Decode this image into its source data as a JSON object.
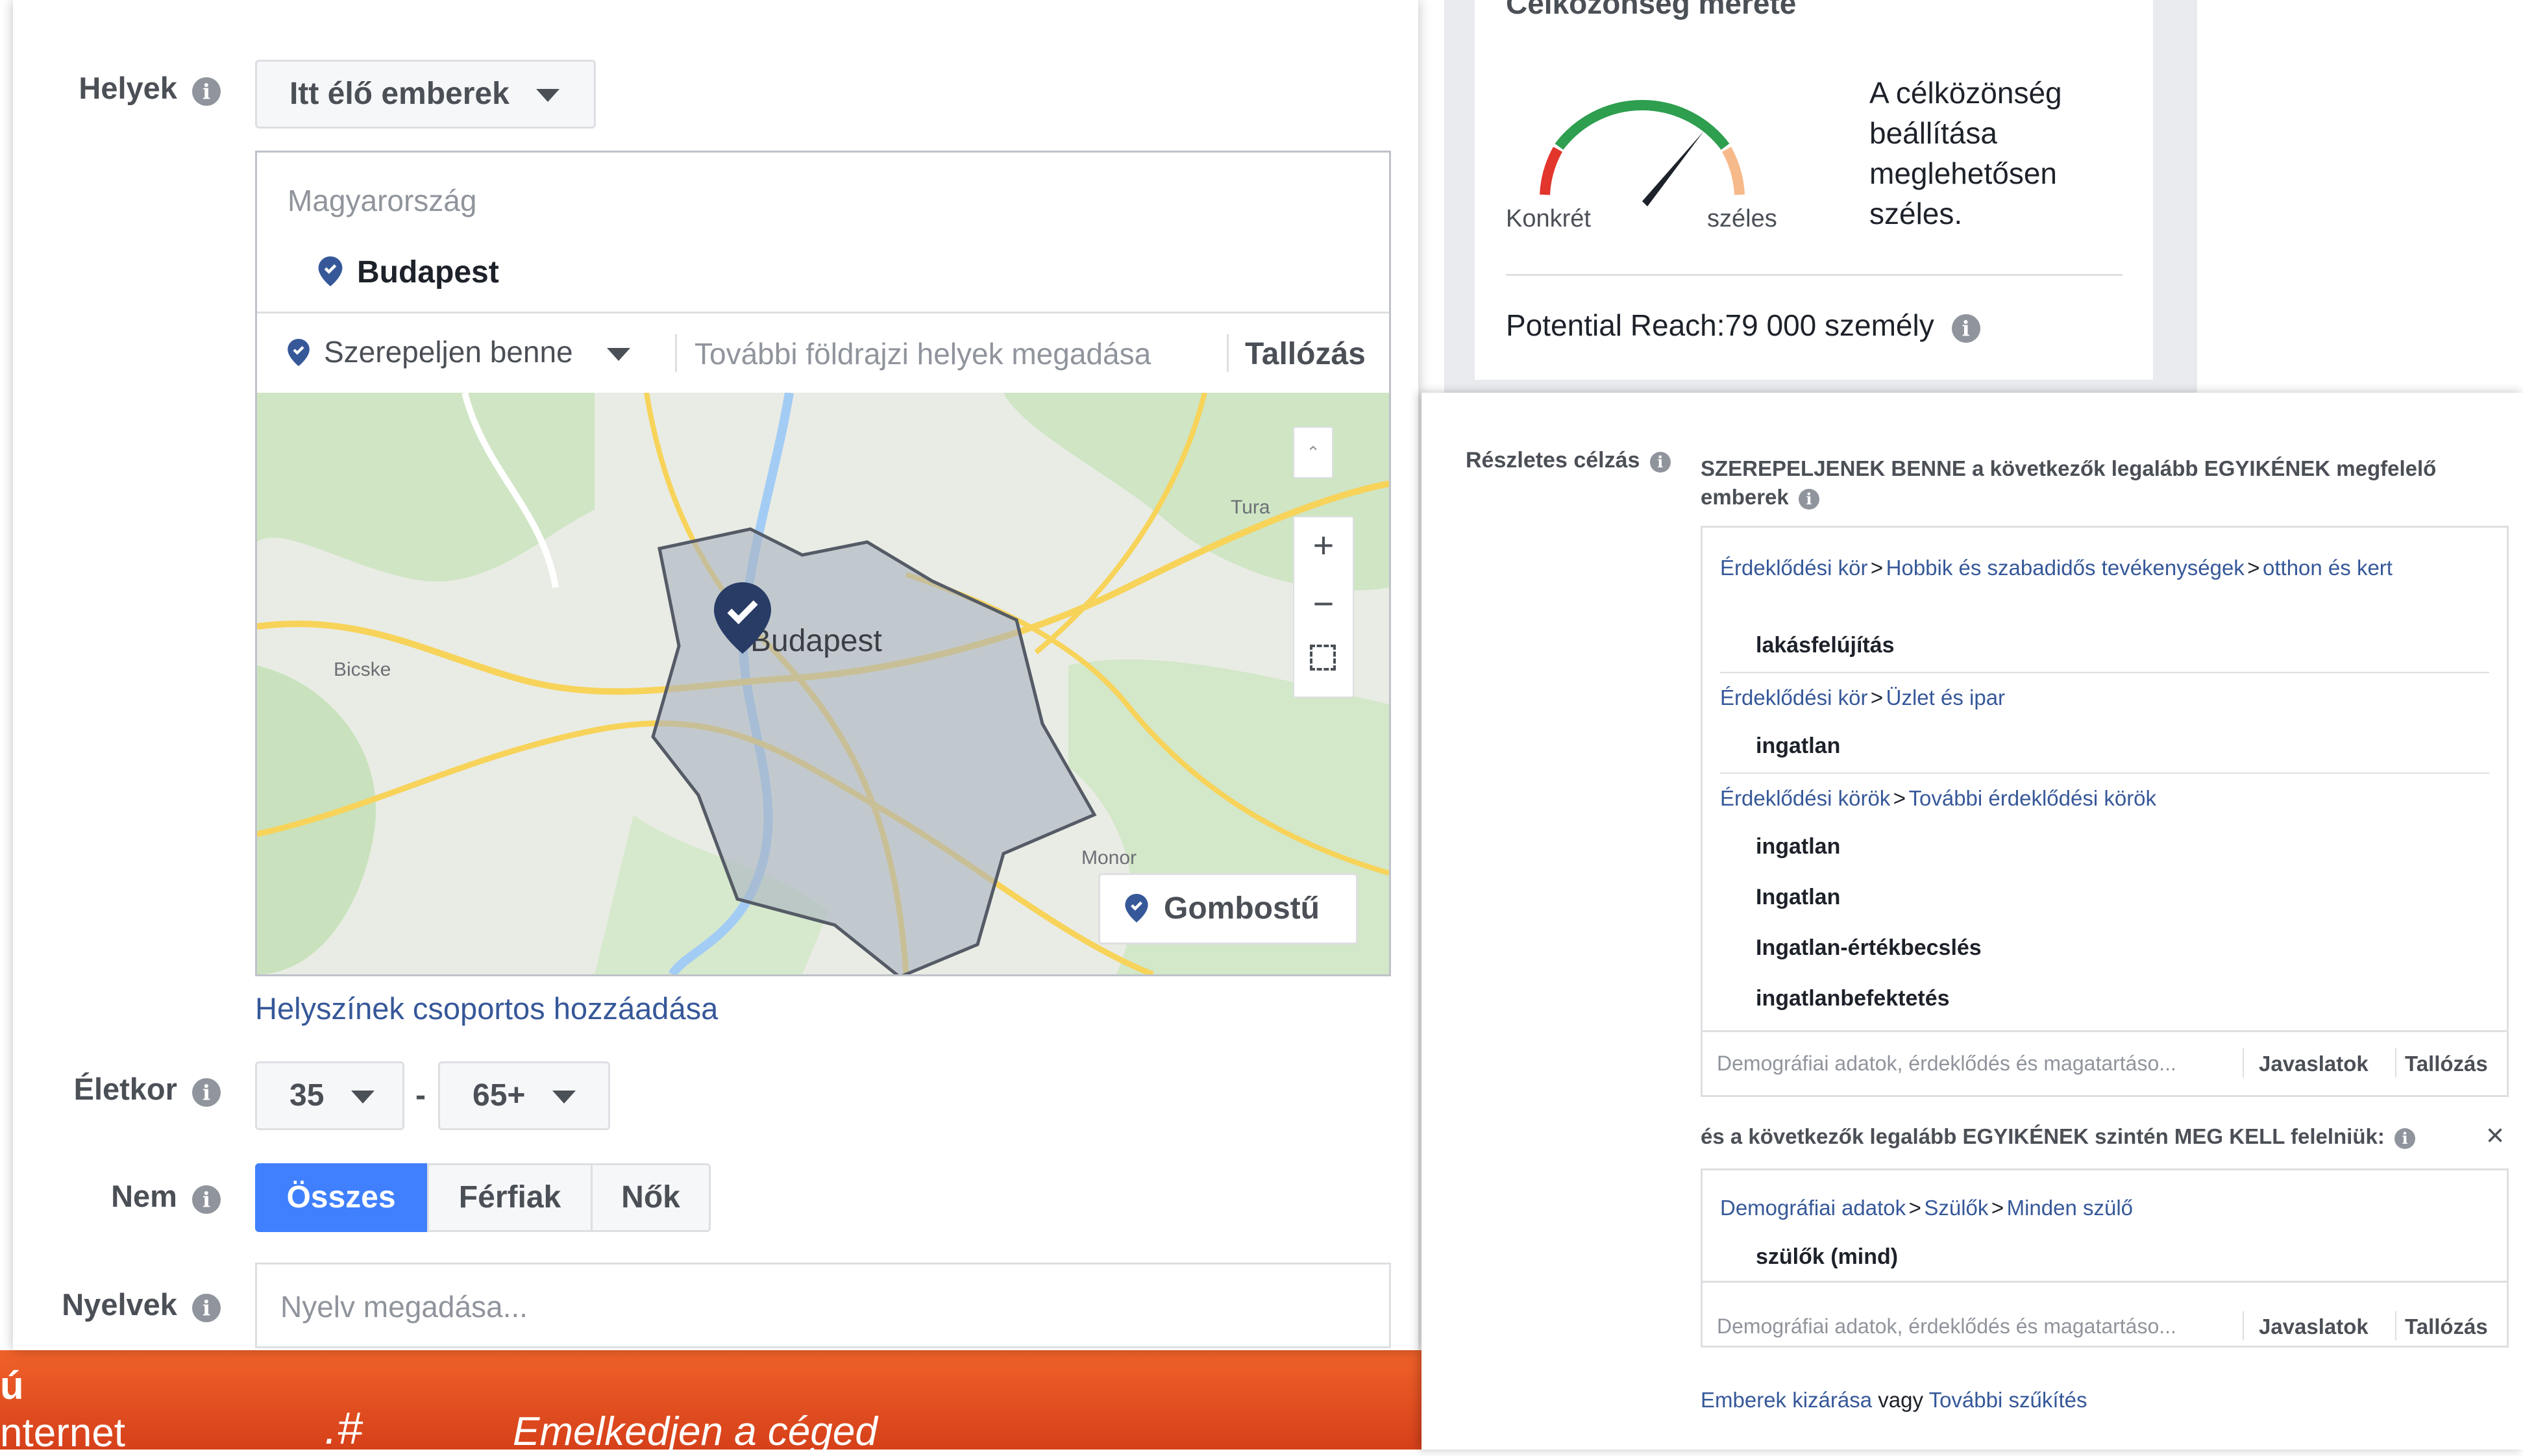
{
  "locations": {
    "label": "Helyek",
    "type_button": "Itt élő emberek",
    "country": "Magyarország",
    "city": "Budapest",
    "include_select": "Szerepeljen benne",
    "search_placeholder": "További földrajzi helyek megadása",
    "browse": "Tallózás",
    "bulk_add": "Helyszínek csoportos hozzáadása"
  },
  "map": {
    "city_label": "Budapest",
    "labels": {
      "tura": "Tura",
      "bicske": "Bicske",
      "monor": "Monor"
    },
    "zoom_in": "+",
    "zoom_out": "−",
    "pin_button": "Gombostű"
  },
  "age": {
    "label": "Életkor",
    "from": "35",
    "dash": "-",
    "to": "65+"
  },
  "gender": {
    "label": "Nem",
    "options": [
      "Összes",
      "Férfiak",
      "Nők"
    ],
    "selected": "Összes"
  },
  "languages": {
    "label": "Nyelvek",
    "placeholder": "Nyelv megadása..."
  },
  "audience": {
    "title": "Célközönség mérete",
    "gauge_left": "Konkrét",
    "gauge_right": "széles",
    "description": "A célközönség beállítása meglehetősen széles.",
    "reach": "Potential Reach:79 000 személy"
  },
  "detailed": {
    "label": "Részletes célzás",
    "include_heading": "SZEREPELJENEK BENNE a következők legalább EGYIKÉNEK megfelelő emberek",
    "groups": [
      {
        "path": [
          "Érdeklődési kör",
          "Hobbik és szabadidős tevékenységek",
          "otthon és kert"
        ],
        "items": [
          "lakásfelújítás"
        ]
      },
      {
        "path": [
          "Érdeklődési kör",
          "Üzlet és ipar"
        ],
        "items": [
          "ingatlan"
        ]
      },
      {
        "path": [
          "Érdeklődési körök",
          "További érdeklődési körök"
        ],
        "items": [
          "ingatlan",
          "Ingatlan",
          "Ingatlan-értékbecslés",
          "ingatlanbefektetés"
        ]
      }
    ],
    "search_placeholder": "Demográfiai adatok, érdeklődés és magatartáso...",
    "suggestions": "Javaslatok",
    "browse": "Tallózás",
    "narrow_heading": "és a következők legalább EGYIKÉNEK szintén MEG KELL felelniük:",
    "narrow_close": "×",
    "narrow_group": {
      "path": [
        "Demográfiai adatok",
        "Szülők",
        "Minden szülő"
      ],
      "items": [
        "szülők (mind)"
      ]
    },
    "footer": {
      "exclude": "Emberek kizárása",
      "or": "vagy",
      "narrow": "További szűkítés"
    }
  },
  "banner": {
    "left_text": "nternet",
    "logo_text": ".#",
    "slogan": "Emelkedjen a céged",
    "fragment": "ú"
  },
  "colors": {
    "accent": "#4080ff",
    "link": "#365899",
    "banner": "#e84c1c"
  },
  "icons": [
    "info-icon",
    "caret-down-icon",
    "map-pin-icon",
    "fullscreen-icon",
    "close-icon"
  ]
}
